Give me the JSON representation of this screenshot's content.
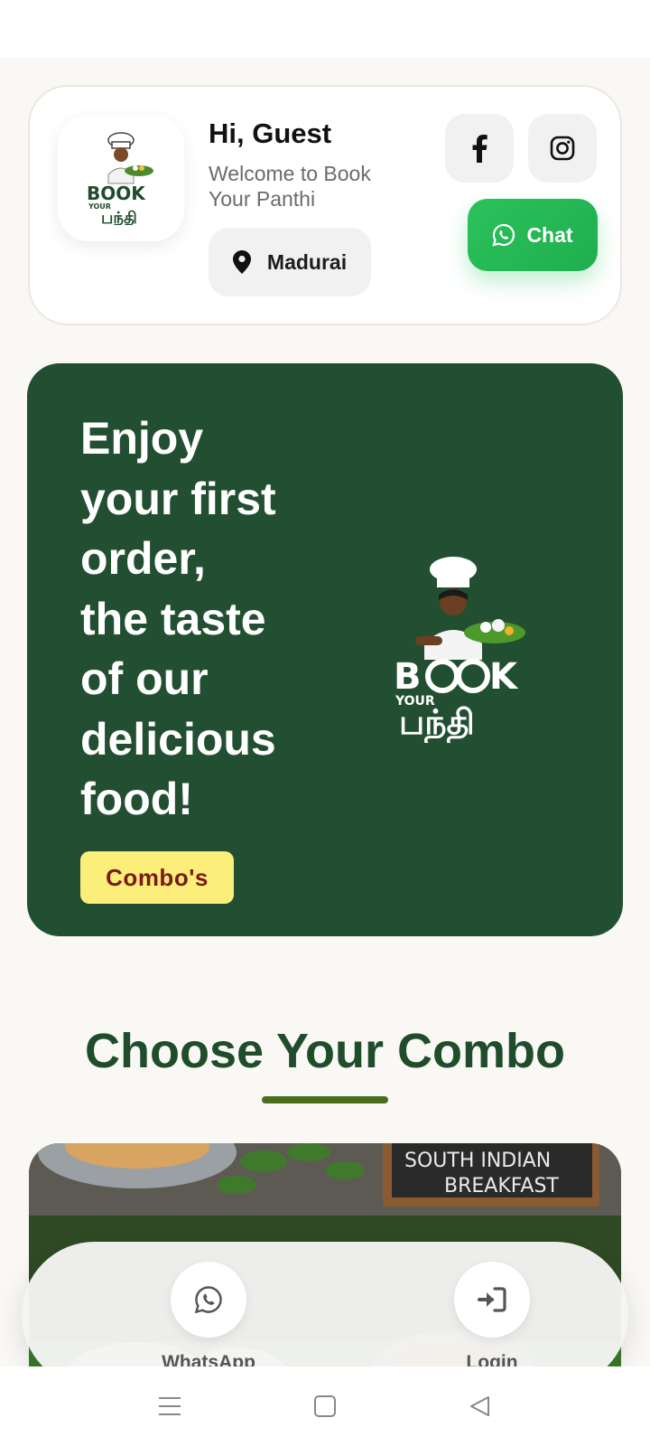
{
  "header": {
    "greeting": "Hi, Guest",
    "welcome": "Welcome to Book Your Panthi",
    "location": "Madurai",
    "chat_label": "Chat",
    "logo_icon": "book-your-panthi-logo"
  },
  "social": {
    "facebook_icon": "facebook-icon",
    "instagram_icon": "instagram-icon"
  },
  "promo": {
    "lines": [
      "Enjoy",
      "your first",
      "order,",
      "the taste",
      "of our",
      "delicious",
      "food!"
    ],
    "button_label": "Combo's",
    "background_color": "#224f31",
    "button_color": "#fbee7b"
  },
  "section": {
    "title": "Choose Your Combo"
  },
  "bottom_nav": {
    "whatsapp_label": "WhatsApp",
    "login_label": "Login"
  },
  "colors": {
    "brand_green": "#224f31",
    "chat_green": "#22c55e",
    "title_green": "#1f4d2b"
  }
}
